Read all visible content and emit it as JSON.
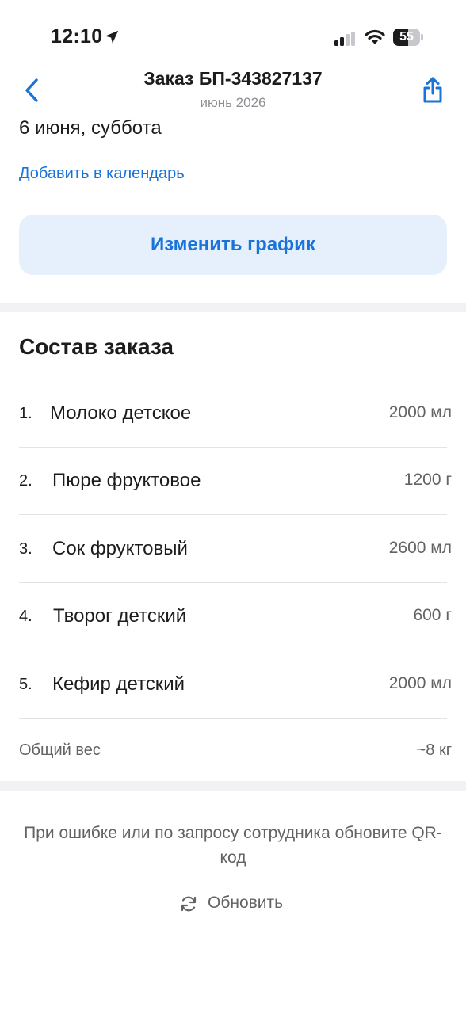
{
  "status_bar": {
    "time": "12:10",
    "battery_level": "55",
    "icons": [
      "location-arrow-icon",
      "cellular-signal-icon",
      "wifi-icon",
      "battery-icon"
    ]
  },
  "nav": {
    "title": "Заказ БП-343827137",
    "subtitle": "июнь 2026",
    "back_icon": "chevron-left-icon",
    "share_icon": "share-icon"
  },
  "schedule": {
    "date": "6 июня, суббота",
    "calendar_link": "Добавить в календарь",
    "change_button": "Изменить график"
  },
  "order": {
    "title": "Состав заказа",
    "items": [
      {
        "num": "1.",
        "name": "Молоко детское",
        "qty": "2000 мл"
      },
      {
        "num": "2.",
        "name": "Пюре фруктовое",
        "qty": "1200 г"
      },
      {
        "num": "3.",
        "name": "Сок фруктовый",
        "qty": "2600 мл"
      },
      {
        "num": "4.",
        "name": "Творог детский",
        "qty": "600 г"
      },
      {
        "num": "5.",
        "name": "Кефир детский",
        "qty": "2000 мл"
      }
    ],
    "total_label": "Общий вес",
    "total_value": "~8 кг"
  },
  "footer": {
    "hint": "При ошибке или по запросу сотрудника обновите QR-код",
    "refresh_label": "Обновить",
    "refresh_icon": "refresh-icon"
  },
  "colors": {
    "accent": "#1a73d8",
    "button_bg": "#e6f0fd",
    "separator": "#f2f2f4",
    "secondary_text": "#636366"
  }
}
